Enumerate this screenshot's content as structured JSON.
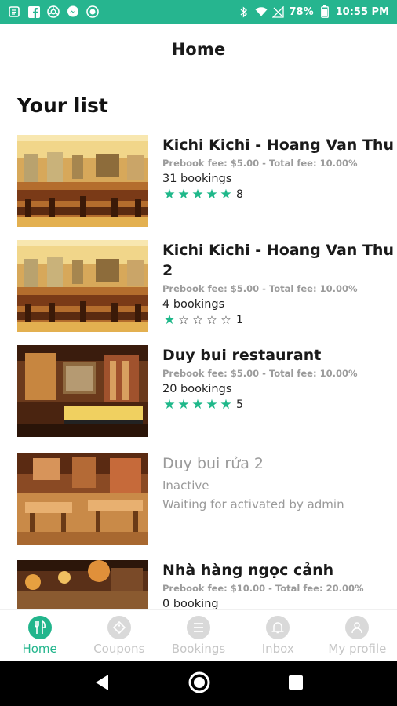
{
  "status_bar": {
    "battery": "78%",
    "time": "10:55 PM",
    "icons": [
      "notification-icon",
      "facebook-icon",
      "chrome-icon",
      "messenger-icon",
      "record-icon",
      "bluetooth-icon",
      "wifi-icon",
      "no-signal-icon",
      "battery-icon"
    ]
  },
  "header": {
    "title": "Home"
  },
  "section": {
    "title": "Your list"
  },
  "restaurants": [
    {
      "name": "Kichi Kichi - Hoang Van Thu",
      "fee": "Prebook fee: $5.00 - Total fee: 10.00%",
      "bookings": "31 bookings",
      "rating": 5,
      "rating_count": "8",
      "active": true
    },
    {
      "name": "Kichi Kichi - Hoang Van Thu 2",
      "fee": "Prebook fee: $5.00 - Total fee: 10.00%",
      "bookings": "4 bookings",
      "rating": 1,
      "rating_count": "1",
      "active": true
    },
    {
      "name": "Duy bui restaurant",
      "fee": "Prebook fee: $5.00 - Total fee: 10.00%",
      "bookings": "20 bookings",
      "rating": 5,
      "rating_count": "5",
      "active": true
    },
    {
      "name": "Duy bui rửa 2",
      "status": "Inactive",
      "status_note": "Waiting for activated by admin",
      "active": false
    },
    {
      "name": "Nhà hàng ngọc cảnh",
      "fee": "Prebook fee: $10.00 - Total fee: 20.00%",
      "bookings": "0 booking",
      "active": true
    }
  ],
  "tabs": [
    {
      "label": "Home",
      "icon": "fork-knife-icon",
      "active": true
    },
    {
      "label": "Coupons",
      "icon": "coupon-icon",
      "active": false
    },
    {
      "label": "Bookings",
      "icon": "list-icon",
      "active": false
    },
    {
      "label": "Inbox",
      "icon": "bell-icon",
      "active": false
    },
    {
      "label": "My profile",
      "icon": "person-icon",
      "active": false
    }
  ],
  "colors": {
    "accent": "#26b58f",
    "star": "#1fb88a",
    "muted": "#9b9b9b"
  }
}
